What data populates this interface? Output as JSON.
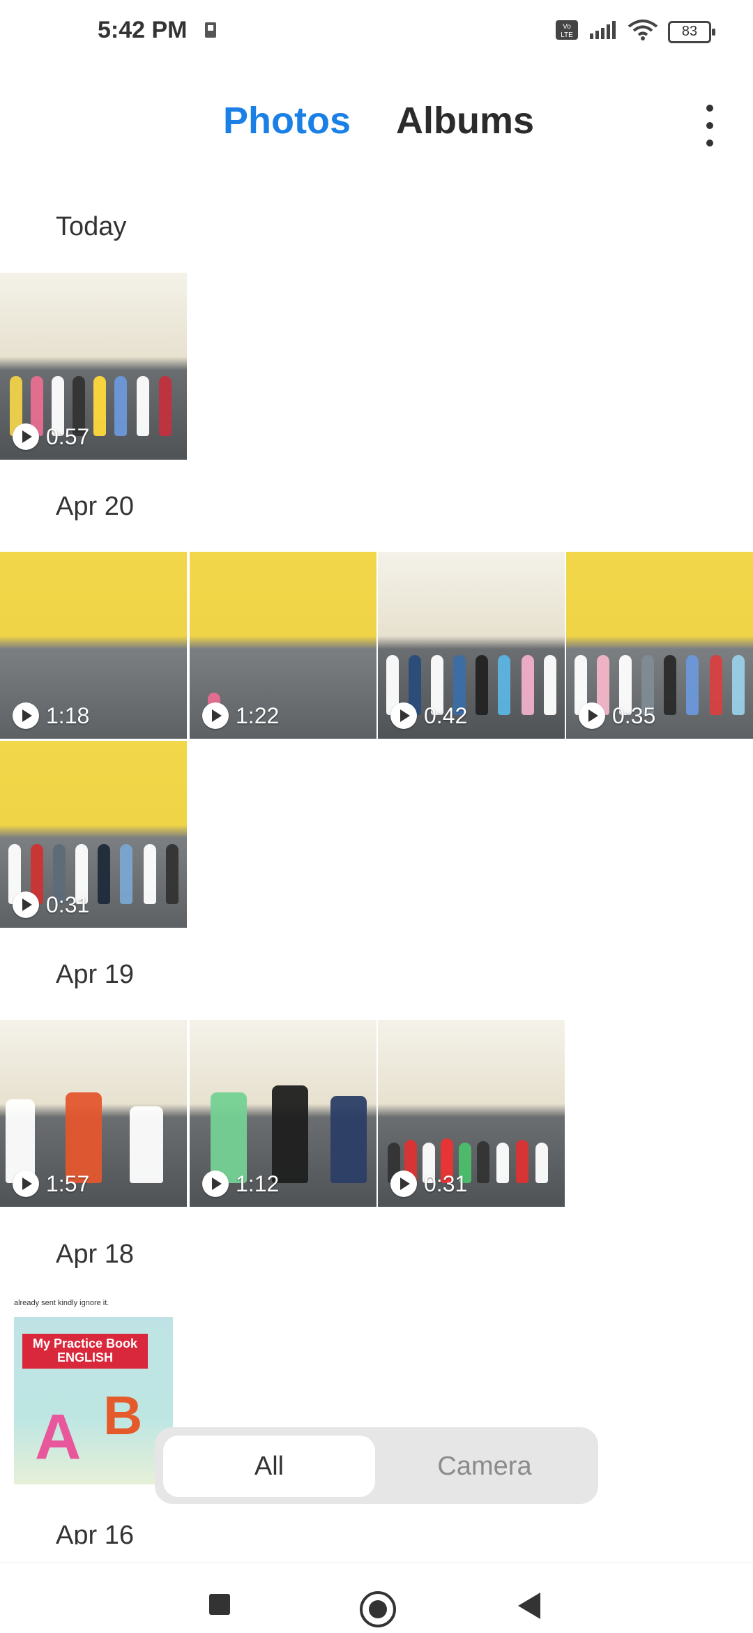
{
  "status_bar": {
    "time": "5:42 PM",
    "battery": "83"
  },
  "header": {
    "tabs": [
      {
        "label": "Photos"
      },
      {
        "label": "Albums"
      }
    ]
  },
  "sections": [
    {
      "date": "Today",
      "items": [
        {
          "duration": "0:57"
        }
      ]
    },
    {
      "date": "Apr 20",
      "items": [
        {
          "duration": "1:18"
        },
        {
          "duration": "1:22"
        },
        {
          "duration": "0:42"
        },
        {
          "duration": "0:35"
        },
        {
          "duration": "0:31"
        }
      ]
    },
    {
      "date": "Apr 19",
      "items": [
        {
          "duration": "1:57"
        },
        {
          "duration": "1:12"
        },
        {
          "duration": "0:31"
        }
      ]
    },
    {
      "date": "Apr 18",
      "items": [
        {
          "note": "already sent kindly ignore it.",
          "book_title": "My Practice Book",
          "book_subject": "ENGLISH"
        }
      ]
    },
    {
      "date": "Apr 16",
      "items": []
    }
  ],
  "filter": {
    "options": [
      {
        "label": "All"
      },
      {
        "label": "Camera"
      }
    ],
    "selected": "All"
  },
  "icons": [
    "more-vertical-icon",
    "play-icon",
    "signal-icon",
    "wifi-icon",
    "battery-icon",
    "recents-icon",
    "home-icon",
    "back-icon"
  ],
  "colors": {
    "accent": "#1a80e6",
    "text": "#2b2b2b",
    "muted": "#8b8b8b"
  }
}
